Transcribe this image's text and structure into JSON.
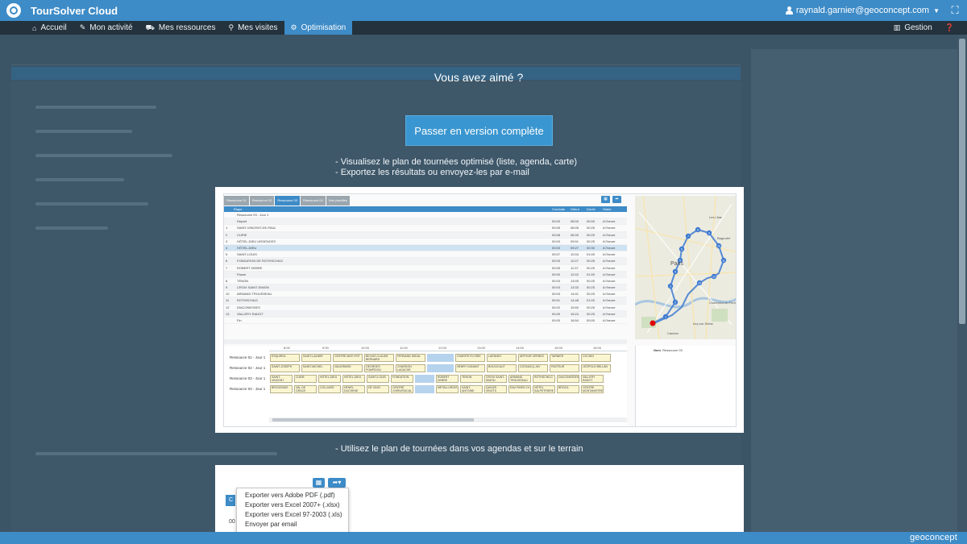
{
  "app": {
    "title": "TourSolver Cloud",
    "user": "raynald.garnier@geoconcept.com",
    "brand": "geoconcept"
  },
  "nav": {
    "left": [
      {
        "label": "Accueil",
        "icon": "home-icon",
        "glyph": "⌂"
      },
      {
        "label": "Mon activité",
        "icon": "pencil-icon",
        "glyph": "✎"
      },
      {
        "label": "Mes ressources",
        "icon": "truck-icon",
        "glyph": "⛟"
      },
      {
        "label": "Mes visites",
        "icon": "location-pin-icon",
        "glyph": "⚲"
      },
      {
        "label": "Optimisation",
        "icon": "gear-icon",
        "glyph": "⚙",
        "active": true
      }
    ],
    "right": [
      {
        "label": "Gestion",
        "icon": "building-icon",
        "glyph": "▥"
      },
      {
        "label": "",
        "icon": "help-icon",
        "glyph": "❓"
      }
    ]
  },
  "promo": {
    "headline": "Vous avez aimé ?",
    "cta": "Passer en version complète",
    "bullets": [
      "- Visualisez le plan de tournées optimisé (liste, agenda, carte)",
      "- Exportez les résultats ou envoyez-les par e-mail"
    ],
    "bullet_agenda": "- Utilisez le plan de tournées dans vos agendas et sur le terrain"
  },
  "previews": {
    "tabs": [
      "Ressource 01",
      "Ressource 02",
      "Ressource 03",
      "Ressource 04",
      "Non planifiés"
    ],
    "active_tab": 2,
    "columns": [
      "Étape",
      "Conduite",
      "Début",
      "Durée",
      "Statut"
    ],
    "rows": [
      {
        "n": "",
        "name": "Ressource 03 - Jour 1",
        "c": "",
        "d": "",
        "du": "",
        "s": ""
      },
      {
        "n": "",
        "name": "Départ",
        "c": "00:00",
        "d": "08:00",
        "du": "00:00",
        "s": "A l'heure"
      },
      {
        "n": "1",
        "name": "SAINT-VINCENT-DE-PAUL",
        "c": "00:05",
        "d": "08:05",
        "du": "00:25",
        "s": "A l'heure"
      },
      {
        "n": "2",
        "name": "CURIE",
        "c": "00:08",
        "d": "08:33",
        "du": "00:25",
        "s": "A l'heure"
      },
      {
        "n": "3",
        "name": "HÔTEL-DIEU URGENCES",
        "c": "00:03",
        "d": "09:01",
        "du": "00:25",
        "s": "A l'heure"
      },
      {
        "n": "4",
        "name": "HÔTEL-DIEU",
        "c": "00:00",
        "d": "09:27",
        "du": "00:30",
        "s": "A l'heure",
        "sel": true
      },
      {
        "n": "5",
        "name": "SAINT-LOUIS",
        "c": "00:07",
        "d": "10:04",
        "du": "01:00",
        "s": "A l'heure"
      },
      {
        "n": "6",
        "name": "FONDATION DE ROTHSCHILD",
        "c": "00:03",
        "d": "11:07",
        "du": "00:25",
        "s": "A l'heure"
      },
      {
        "n": "7",
        "name": "ROBERT DEBRE",
        "c": "00:05",
        "d": "11:37",
        "du": "00:25",
        "s": "A l'heure"
      },
      {
        "n": "",
        "name": "Pause",
        "c": "00:00",
        "d": "12:02",
        "du": "01:00",
        "s": "A l'heure"
      },
      {
        "n": "8",
        "name": "TENON",
        "c": "00:03",
        "d": "13:05",
        "du": "00:25",
        "s": "A l'heure"
      },
      {
        "n": "9",
        "name": "CROIX SAINT-SIMON",
        "c": "00:03",
        "d": "13:33",
        "du": "00:25",
        "s": "A l'heure"
      },
      {
        "n": "10",
        "name": "ARMAND TROUSSEAU",
        "c": "00:03",
        "d": "14:01",
        "du": "00:25",
        "s": "A l'heure"
      },
      {
        "n": "11",
        "name": "ROTHSCHILD",
        "c": "00:01",
        "d": "14:48",
        "du": "01:00",
        "s": "A l'heure"
      },
      {
        "n": "12",
        "name": "DIACONESSES",
        "c": "00:02",
        "d": "15:50",
        "du": "00:25",
        "s": "A l'heure"
      },
      {
        "n": "13",
        "name": "VALLERY RADOT",
        "c": "00:09",
        "d": "16:24",
        "du": "00:25",
        "s": "A l'heure"
      },
      {
        "n": "",
        "name": "Fin",
        "c": "00:03",
        "d": "16:54",
        "du": "00:00",
        "s": "A l'heure"
      }
    ],
    "hours": [
      "8:00",
      "9:00",
      "10:00",
      "11:00",
      "12:00",
      "13:00",
      "14:00",
      "15:00",
      "16:00"
    ],
    "gantt": [
      {
        "label": "Ressource 01 - Jour 1",
        "stops": [
          "ESQUIROL",
          "SAINT-LAZARE",
          "CENTRE MATI-POT",
          "BICHAT-CLAUDE BERNARD",
          "FERNAND WIDAL",
          "CHARITÉ ÉLYSÉE",
          "LAENNEC",
          "ARTHUR VERNES",
          "TARNIER",
          "COCHIN"
        ]
      },
      {
        "label": "Ressource 02 - Jour 1",
        "stops": [
          "SAINT-JOSEPH",
          "SAINT-MICHEL",
          "VAUGIRARD",
          "GEORGES POMPIDOU",
          "CHARDON LAGACHE",
          "HENRY DUNANT",
          "BOUCICAUT",
          "COGNACQ-JAY",
          "PASTEUR",
          "LEOPOLD BELLAN"
        ]
      },
      {
        "label": "Ressource 03 - Jour 1",
        "stops": [
          "SAINT-VINCENT",
          "CURIE",
          "HÔTEL-DIEU",
          "HÔTEL-DIEU",
          "SAINT-LOUIS",
          "FONDATION",
          "ROBERT DEBRE",
          "TENON",
          "CROIX SAINT-SIMON",
          "ARMAND TROUSSEAU",
          "ROTHSCHILD",
          "DIACONESSES",
          "VALLERY RADOT"
        ]
      },
      {
        "label": "Ressource 04 - Jour 1",
        "stops": [
          "BROUSSAIS",
          "VAL DE GRACE",
          "COLLIARD",
          "HENRI-DUCHENE",
          "DE VINCI",
          "CENTRE CHIRURGICAL",
          "METALLURGISTES",
          "SAINT-ANTOINE",
          "QUINZE-VINGTS",
          "EAU PARIS VII",
          "HÔTEL SALPETRIERE",
          "BROCA",
          "CENTRE MONTMARTRE"
        ]
      }
    ],
    "detail_label": "Nom",
    "detail_value": "Ressource 03",
    "map_labels": [
      "Paris",
      "Les Lilas",
      "Bagnolet",
      "Charenton-le-Pont",
      "Ivry-sur-Seine",
      "Cachan"
    ],
    "route_markers": [
      "1",
      "2",
      "3",
      "4",
      "5",
      "6",
      "7",
      "8",
      "9",
      "10",
      "11",
      "12",
      "13"
    ],
    "export_menu": [
      "Exporter vers Adobe PDF (.pdf)",
      "Exporter vers Excel 2007+ (.xlsx)",
      "Exporter vers Excel 97-2003 (.xls)",
      "Envoyer par email"
    ],
    "export_side": "C",
    "export_code": "00"
  },
  "colors": {
    "accent": "#3d8bc7",
    "navbar": "#23323c",
    "overlay": "#3c5566"
  }
}
